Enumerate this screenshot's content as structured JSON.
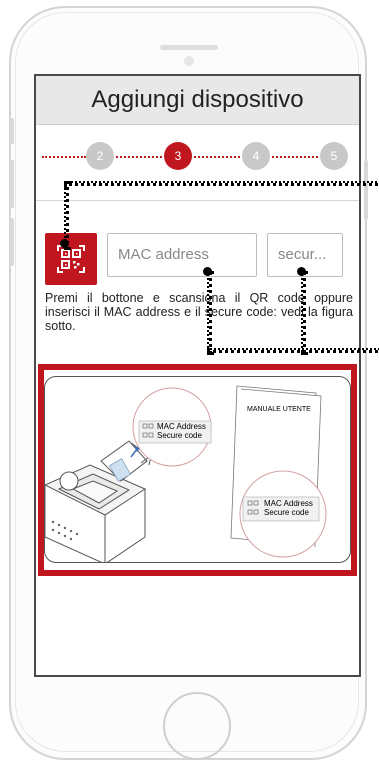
{
  "header": {
    "title": "Aggiungi dispositivo"
  },
  "stepper": {
    "steps": [
      "2",
      "3",
      "4",
      "5"
    ],
    "active_step": "3"
  },
  "form": {
    "qr_button_icon": "qr-code-scan-icon",
    "mac_placeholder": "MAC address",
    "secure_placeholder": "secur..."
  },
  "instructions": "Premi il bottone e scansiona il QR code oppure inserisci il MAC address e il secure code: vedi la figura sotto.",
  "illustration": {
    "manual_title": "MANUALE UTENTE",
    "device_label_mac": "MAC Address",
    "device_label_secure": "Secure code",
    "manual_label_mac": "MAC Address",
    "manual_label_secure": "Secure code"
  },
  "colors": {
    "accent": "#c0161f",
    "step_inactive": "#c8c8c8",
    "header_bg": "#e8e8e8"
  }
}
